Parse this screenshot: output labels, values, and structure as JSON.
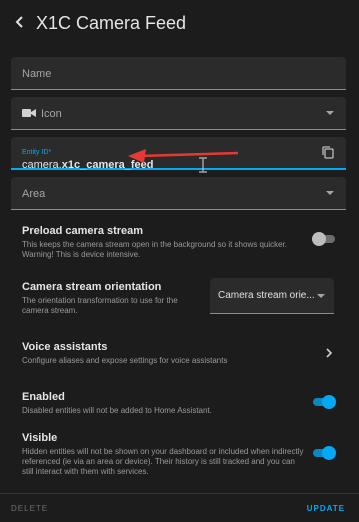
{
  "header": {
    "title": "X1C Camera Feed"
  },
  "fields": {
    "name_label": "Name",
    "icon_label": "Icon",
    "entity_small_label": "Entity ID*",
    "entity_prefix": "camera.",
    "entity_name": "x1c_camera_feed",
    "area_label": "Area"
  },
  "settings": {
    "preload": {
      "title": "Preload camera stream",
      "desc": "This keeps the camera stream open in the background so it shows quicker. Warning! This is device intensive.",
      "enabled": false
    },
    "orientation": {
      "title": "Camera stream orientation",
      "desc": "The orientation transformation to use for the camera stream.",
      "selected": "Camera stream orie..."
    },
    "voice": {
      "title": "Voice assistants",
      "desc": "Configure aliases and expose settings for voice assistants"
    },
    "enabled": {
      "title": "Enabled",
      "desc": "Disabled entities will not be added to Home Assistant.",
      "on": true
    },
    "visible": {
      "title": "Visible",
      "desc": "Hidden entities will not be shown on your dashboard or included when indirectly referenced (ie via an area or device). Their history is still tracked and you can still interact with them with services.",
      "on": true
    }
  },
  "footer": {
    "delete_label": "DELETE",
    "update_label": "UPDATE"
  },
  "colors": {
    "accent": "#03a9f4",
    "annotation_arrow": "#e53935",
    "background": "#1c1c1c"
  },
  "icons": [
    "chevron-left-icon",
    "video-icon",
    "copy-icon",
    "text-cursor-icon",
    "chevron-right-icon",
    "caret-down-icon"
  ]
}
